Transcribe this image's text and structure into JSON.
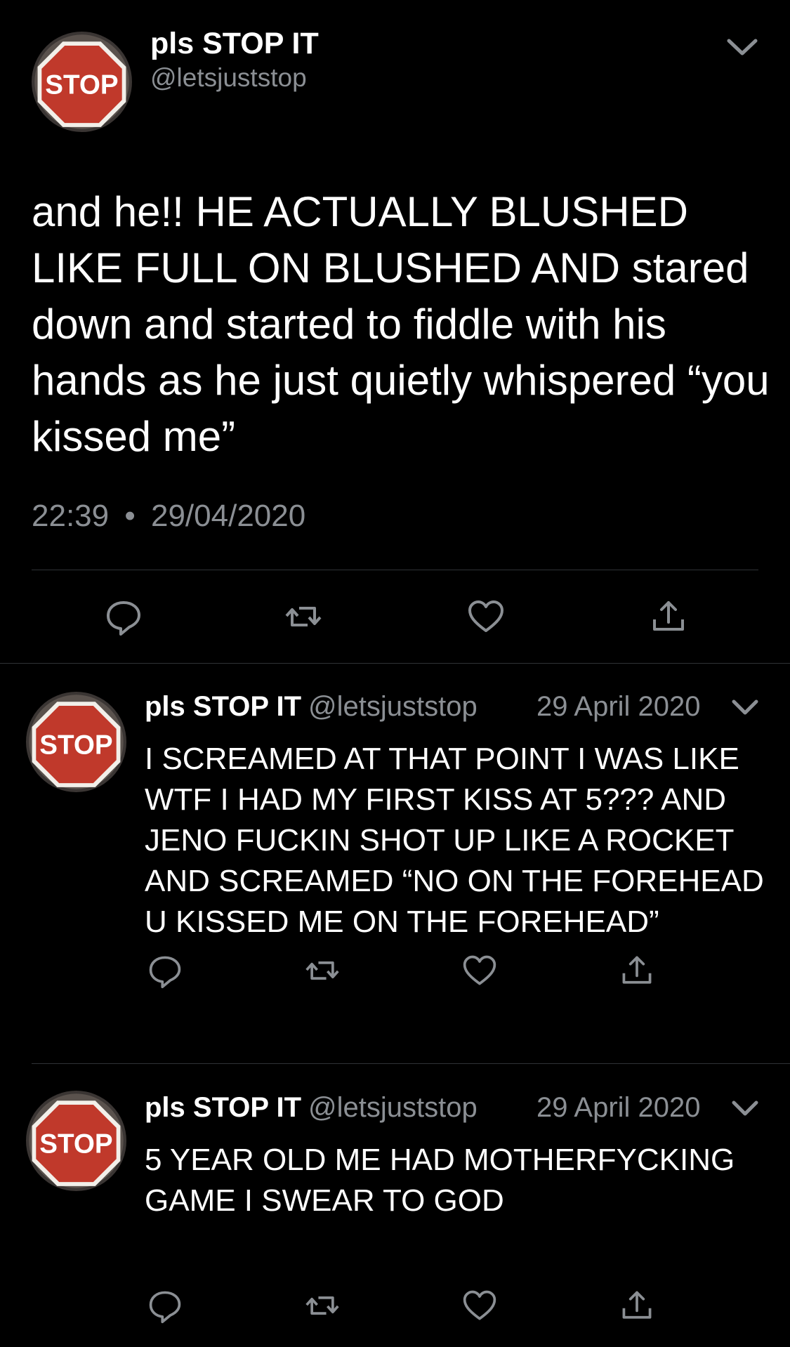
{
  "main_tweet": {
    "author_name": "pls STOP IT",
    "handle": "@letsjuststop",
    "avatar_label": "STOP",
    "text": "and he!! HE ACTUALLY BLUSHED LIKE FULL ON BLUSHED AND stared down and started to fiddle with his hands as he just quietly whispered “you kissed me”",
    "time": "22:39",
    "separator": "•",
    "date": "29/04/2020"
  },
  "replies": [
    {
      "author_name": "pls STOP IT",
      "handle": "@letsjuststop",
      "date": "29 April 2020",
      "avatar_label": "STOP",
      "text": "I SCREAMED AT THAT POINT I WAS LIKE WTF I HAD MY FIRST KISS AT 5??? AND JENO FUCKIN SHOT UP LIKE A ROCKET AND SCREAMED “NO ON THE FOREHEAD U KISSED ME ON THE FOREHEAD”"
    },
    {
      "author_name": "pls STOP IT",
      "handle": "@letsjuststop",
      "date": "29 April 2020",
      "avatar_label": "STOP",
      "text": "5 YEAR OLD ME HAD MOTHERFYCKING GAME I SWEAR TO GOD"
    }
  ],
  "actions": [
    "reply-icon",
    "retweet-icon",
    "like-icon",
    "share-icon"
  ],
  "colors": {
    "background": "#000000",
    "text": "#ffffff",
    "secondary_text": "#8b8f94",
    "divider": "#2f3336",
    "icon": "#8b8f94",
    "stop_sign": "#c0392b"
  }
}
